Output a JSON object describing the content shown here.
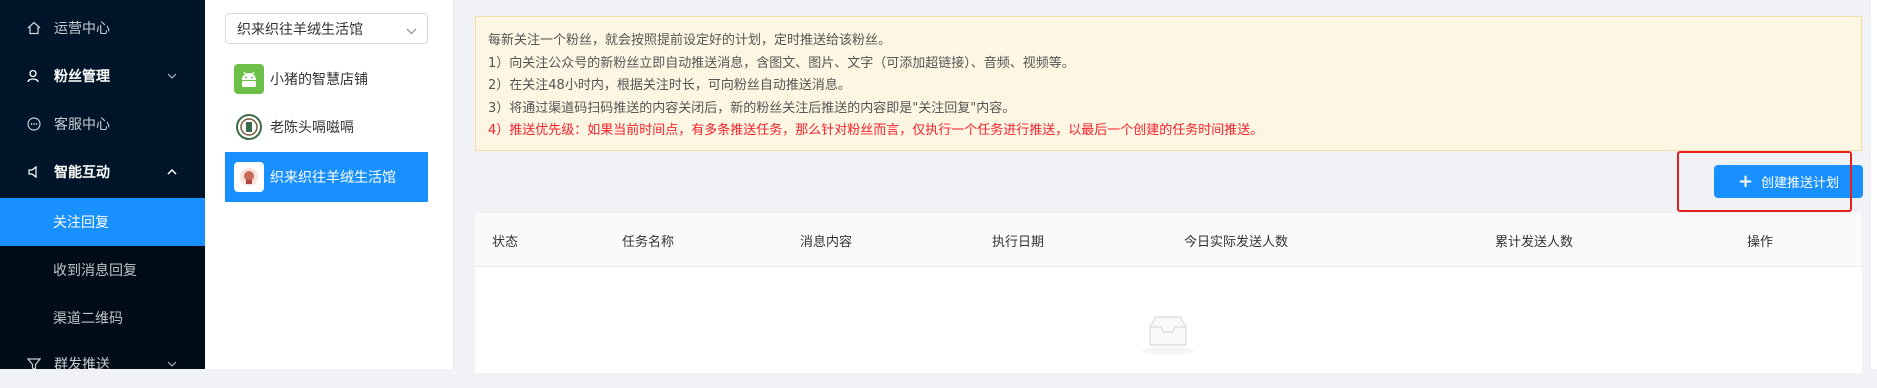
{
  "sidebar": {
    "items": [
      {
        "label": "运营中心",
        "icon": "home-icon"
      },
      {
        "label": "粉丝管理",
        "icon": "user-icon"
      },
      {
        "label": "客服中心",
        "icon": "chat-icon"
      },
      {
        "label": "智能互动",
        "icon": "sound-icon"
      },
      {
        "label": "群发推送",
        "icon": "filter-icon"
      }
    ],
    "submenu": [
      {
        "label": "关注回复"
      },
      {
        "label": "收到消息回复"
      },
      {
        "label": "渠道二维码"
      }
    ]
  },
  "stores": {
    "selected": "织来织往羊绒生活馆",
    "items": [
      {
        "name": "小猪的智慧店铺"
      },
      {
        "name": "老陈头嗝嗞嗝"
      },
      {
        "name": "织来织往羊绒生活馆"
      }
    ]
  },
  "notice": {
    "line0": "每新关注一个粉丝，就会按照提前设定好的计划，定时推送给该粉丝。",
    "line1": "1）向关注公众号的新粉丝立即自动推送消息，含图文、图片、文字（可添加超链接）、音频、视频等。",
    "line2": "2）在关注48小时内，根据关注时长，可向粉丝自动推送消息。",
    "line3": "3）将通过渠道码扫码推送的内容关闭后，新的粉丝关注后推送的内容即是\"关注回复\"内容。",
    "line4_prefix": "4）",
    "line4_red": "推送优先级：如果当前时间点，有多条推送任务，那么针对粉丝而言，仅执行一个任务进行推送，以最后一个创建的任务时间推送。"
  },
  "actions": {
    "create_label": "创建推送计划"
  },
  "table": {
    "headers": [
      "状态",
      "任务名称",
      "消息内容",
      "执行日期",
      "今日实际发送人数",
      "累计发送人数",
      "操作"
    ]
  },
  "colors": {
    "sidebar_bg": "#001529",
    "accent": "#1890ff",
    "notice_bg": "#fdf6e3",
    "warning_red": "#f5222d",
    "highlight": "#e8201c"
  }
}
